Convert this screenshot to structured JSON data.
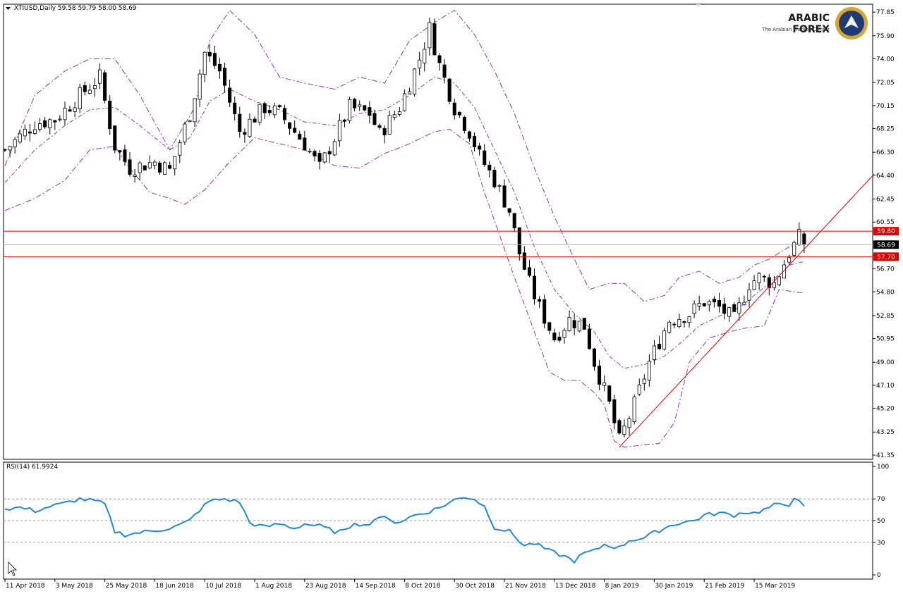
{
  "window": {
    "symbol_header": "XTIUSD,Daily  59.58 59.79 58.00 58.69",
    "indicator_header": "RSI(14) 61.9924"
  },
  "brand": {
    "name": "ARABIC FOREX",
    "tagline": "The Arabian Trading Center"
  },
  "colors": {
    "bull_body": "#ffffff",
    "bear_body": "#000000",
    "bands": "#9b2fae",
    "levels": "#e00000",
    "trendline": "#e00000",
    "rsi_line": "#1e88e5",
    "grid": "#cfcfcf"
  },
  "chart_data": [
    {
      "type": "candlestick",
      "price_axis": {
        "ticks": [
          "77.85",
          "75.90",
          "74.00",
          "72.05",
          "70.15",
          "68.25",
          "66.30",
          "64.40",
          "62.45",
          "60.55",
          "56.70",
          "54.80",
          "52.85",
          "50.95",
          "49.00",
          "47.10",
          "45.20",
          "43.25",
          "41.35"
        ],
        "range": [
          41.0,
          78.5
        ]
      },
      "time_axis": {
        "labels": [
          "11 Apr 2018",
          "3 May 2018",
          "25 May 2018",
          "18 Jun 2018",
          "10 Jul 2018",
          "1 Aug 2018",
          "23 Aug 2018",
          "14 Sep 2018",
          "8 Oct 2018",
          "30 Oct 2018",
          "21 Nov 2018",
          "13 Dec 2018",
          "8 Jan 2019",
          "30 Jan 2019",
          "21 Feb 2019",
          "15 Mar 2019"
        ]
      },
      "price_levels": [
        {
          "label": "59.80",
          "value": 59.8,
          "style": "red"
        },
        {
          "label": "58.69",
          "value": 58.69,
          "style": "current"
        },
        {
          "label": "57.70",
          "value": 57.7,
          "style": "red"
        }
      ],
      "close_path": [
        [
          0,
          66.5
        ],
        [
          6,
          68.7
        ],
        [
          10,
          69.0
        ],
        [
          15,
          71.0
        ],
        [
          19,
          72.5
        ],
        [
          20,
          70.5
        ],
        [
          22,
          66.8
        ],
        [
          25,
          65.0
        ],
        [
          30,
          65.5
        ],
        [
          33,
          64.8
        ],
        [
          37,
          69.5
        ],
        [
          40,
          74.5
        ],
        [
          43,
          73.0
        ],
        [
          45,
          70.5
        ],
        [
          47,
          68.0
        ],
        [
          52,
          70.0
        ],
        [
          55,
          69.5
        ],
        [
          60,
          67.0
        ],
        [
          63,
          65.0
        ],
        [
          66,
          67.5
        ],
        [
          69,
          70.0
        ],
        [
          73,
          69.5
        ],
        [
          75,
          67.8
        ],
        [
          79,
          70.0
        ],
        [
          83,
          74.0
        ],
        [
          85,
          76.5
        ],
        [
          87,
          73.5
        ],
        [
          90,
          70.0
        ],
        [
          93,
          68.0
        ],
        [
          95,
          66.0
        ],
        [
          98,
          64.0
        ],
        [
          101,
          61.5
        ],
        [
          103,
          58.0
        ],
        [
          105,
          55.5
        ],
        [
          107,
          53.5
        ],
        [
          110,
          51.0
        ],
        [
          113,
          52.5
        ],
        [
          116,
          52.0
        ],
        [
          118,
          49.0
        ],
        [
          121,
          45.5
        ],
        [
          123,
          42.5
        ],
        [
          126,
          45.5
        ],
        [
          129,
          49.0
        ],
        [
          133,
          52.5
        ],
        [
          137,
          53.0
        ],
        [
          140,
          54.0
        ],
        [
          143,
          53.5
        ],
        [
          146,
          52.5
        ],
        [
          149,
          55.5
        ],
        [
          151,
          56.0
        ],
        [
          154,
          55.5
        ],
        [
          157,
          58.0
        ],
        [
          159,
          59.3
        ],
        [
          160,
          58.69
        ]
      ],
      "upper_band_path": [
        [
          0,
          65.2
        ],
        [
          6,
          71.0
        ],
        [
          12,
          73.0
        ],
        [
          17,
          74.0
        ],
        [
          22,
          74.0
        ],
        [
          27,
          71.0
        ],
        [
          33,
          66.5
        ],
        [
          38,
          70.0
        ],
        [
          41,
          75.5
        ],
        [
          45,
          78.0
        ],
        [
          50,
          76.0
        ],
        [
          55,
          72.5
        ],
        [
          60,
          72.0
        ],
        [
          66,
          71.5
        ],
        [
          71,
          72.5
        ],
        [
          76,
          72.0
        ],
        [
          81,
          75.5
        ],
        [
          86,
          77.0
        ],
        [
          90,
          78.0
        ],
        [
          94,
          76.0
        ],
        [
          98,
          73.0
        ],
        [
          102,
          69.5
        ],
        [
          106,
          65.0
        ],
        [
          110,
          61.0
        ],
        [
          114,
          57.5
        ],
        [
          117,
          55.0
        ],
        [
          121,
          55.5
        ],
        [
          124,
          55.5
        ],
        [
          128,
          54.0
        ],
        [
          132,
          54.5
        ],
        [
          135,
          56.0
        ],
        [
          139,
          56.5
        ],
        [
          143,
          55.5
        ],
        [
          147,
          56.0
        ],
        [
          150,
          57.0
        ],
        [
          153,
          57.5
        ],
        [
          157,
          58.5
        ],
        [
          160,
          59.0
        ]
      ],
      "middle_band_path": [
        [
          0,
          63.8
        ],
        [
          6,
          66.5
        ],
        [
          12,
          68.5
        ],
        [
          17,
          69.8
        ],
        [
          22,
          70.0
        ],
        [
          27,
          68.5
        ],
        [
          33,
          66.5
        ],
        [
          37,
          67.5
        ],
        [
          41,
          70.5
        ],
        [
          45,
          71.5
        ],
        [
          50,
          70.5
        ],
        [
          55,
          69.8
        ],
        [
          60,
          68.8
        ],
        [
          66,
          68.5
        ],
        [
          71,
          69.5
        ],
        [
          76,
          69.8
        ],
        [
          81,
          71.0
        ],
        [
          86,
          72.5
        ],
        [
          90,
          72.0
        ],
        [
          94,
          70.0
        ],
        [
          98,
          66.5
        ],
        [
          102,
          63.0
        ],
        [
          106,
          58.5
        ],
        [
          110,
          55.0
        ],
        [
          114,
          53.0
        ],
        [
          118,
          51.5
        ],
        [
          121,
          49.5
        ],
        [
          124,
          48.5
        ],
        [
          128,
          48.8
        ],
        [
          132,
          49.5
        ],
        [
          135,
          50.5
        ],
        [
          139,
          52.0
        ],
        [
          143,
          52.8
        ],
        [
          147,
          53.5
        ],
        [
          150,
          54.5
        ],
        [
          153,
          55.5
        ],
        [
          157,
          57.0
        ],
        [
          160,
          57.3
        ]
      ],
      "lower_band_path": [
        [
          0,
          61.5
        ],
        [
          3,
          62.0
        ],
        [
          6,
          62.5
        ],
        [
          12,
          64.0
        ],
        [
          17,
          66.5
        ],
        [
          22,
          66.8
        ],
        [
          25,
          65.0
        ],
        [
          29,
          63.0
        ],
        [
          33,
          62.5
        ],
        [
          36,
          62.0
        ],
        [
          40,
          63.2
        ],
        [
          45,
          65.5
        ],
        [
          50,
          67.5
        ],
        [
          55,
          67.0
        ],
        [
          60,
          66.5
        ],
        [
          66,
          65.2
        ],
        [
          71,
          65.0
        ],
        [
          76,
          66.2
        ],
        [
          81,
          67.0
        ],
        [
          86,
          68.0
        ],
        [
          89,
          68.2
        ],
        [
          93,
          67.0
        ],
        [
          96,
          63.0
        ],
        [
          99,
          59.5
        ],
        [
          102,
          56.0
        ],
        [
          106,
          51.5
        ],
        [
          109,
          48.2
        ],
        [
          112,
          47.5
        ],
        [
          115,
          47.5
        ],
        [
          118,
          46.5
        ],
        [
          120,
          45.5
        ],
        [
          122,
          42.5
        ],
        [
          124,
          42.0
        ],
        [
          128,
          42.2
        ],
        [
          131,
          42.3
        ],
        [
          134,
          44.0
        ],
        [
          137,
          49.0
        ],
        [
          141,
          51.0
        ],
        [
          145,
          51.5
        ],
        [
          148,
          51.8
        ],
        [
          152,
          52.0
        ],
        [
          155,
          55.0
        ],
        [
          158,
          54.8
        ],
        [
          160,
          54.7
        ]
      ],
      "trendline": {
        "from": [
          123,
          42.0
        ],
        "to": [
          174,
          64.5
        ]
      }
    },
    {
      "type": "line",
      "indicator": "RSI(14)",
      "y_axis": {
        "ticks": [
          "100",
          "70",
          "50",
          "30",
          "0"
        ],
        "range": [
          0,
          100
        ],
        "levels": [
          70,
          50,
          30
        ]
      },
      "path": [
        [
          0,
          61
        ],
        [
          3,
          62
        ],
        [
          6,
          59
        ],
        [
          9,
          63
        ],
        [
          12,
          66
        ],
        [
          15,
          70
        ],
        [
          18,
          68
        ],
        [
          20,
          65
        ],
        [
          22,
          40
        ],
        [
          24,
          37
        ],
        [
          27,
          39
        ],
        [
          30,
          41
        ],
        [
          33,
          43
        ],
        [
          35,
          46
        ],
        [
          37,
          50
        ],
        [
          39,
          60
        ],
        [
          41,
          68
        ],
        [
          44,
          70
        ],
        [
          47,
          67
        ],
        [
          49,
          48
        ],
        [
          52,
          44
        ],
        [
          55,
          47
        ],
        [
          58,
          43
        ],
        [
          60,
          47
        ],
        [
          63,
          45
        ],
        [
          66,
          40
        ],
        [
          68,
          40
        ],
        [
          70,
          49
        ],
        [
          72,
          45
        ],
        [
          75,
          54
        ],
        [
          77,
          50
        ],
        [
          79,
          49
        ],
        [
          82,
          55
        ],
        [
          84,
          57
        ],
        [
          87,
          62
        ],
        [
          90,
          69
        ],
        [
          92,
          72
        ],
        [
          94,
          70
        ],
        [
          96,
          63
        ],
        [
          98,
          44
        ],
        [
          101,
          40
        ],
        [
          104,
          27
        ],
        [
          106,
          29
        ],
        [
          109,
          22
        ],
        [
          112,
          17
        ],
        [
          114,
          13
        ],
        [
          116,
          20
        ],
        [
          118,
          22
        ],
        [
          120,
          28
        ],
        [
          123,
          25
        ],
        [
          125,
          32
        ],
        [
          128,
          34
        ],
        [
          130,
          39
        ],
        [
          133,
          45
        ],
        [
          135,
          48
        ],
        [
          138,
          50
        ],
        [
          140,
          55
        ],
        [
          143,
          57
        ],
        [
          146,
          55
        ],
        [
          148,
          58
        ],
        [
          150,
          57
        ],
        [
          152,
          60
        ],
        [
          154,
          64
        ],
        [
          157,
          65
        ],
        [
          158,
          72
        ],
        [
          160,
          62
        ]
      ]
    }
  ]
}
